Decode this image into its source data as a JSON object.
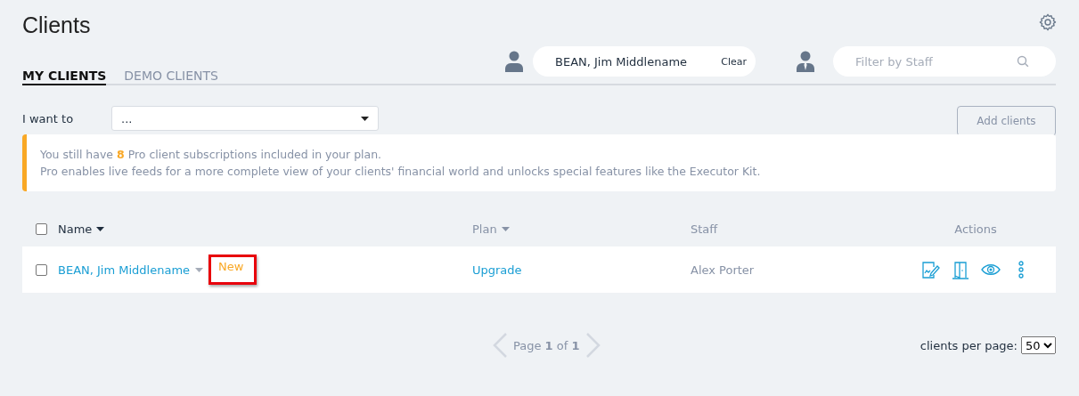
{
  "title": "Clients",
  "tabs": [
    {
      "label": "MY CLIENTS",
      "selected": true
    },
    {
      "label": "DEMO CLIENTS",
      "selected": false
    }
  ],
  "client_search": {
    "value": "BEAN, Jim Middlename",
    "clear_label": "Clear"
  },
  "staff_filter": {
    "placeholder": "Filter by Staff"
  },
  "action_select": {
    "label": "I want to",
    "value": "..."
  },
  "add_button": "Add clients",
  "notice": {
    "lines": [
      "You still have **8** Pro client subscriptions included in your plan.",
      "Pro enables live feeds for a more complete view of your clients' financial world and unlocks special features like the Executor Kit."
    ]
  },
  "table": {
    "select_all_checked": false,
    "columns": [
      {
        "label": "Name",
        "sortable": true,
        "sorted": true
      },
      {
        "label": "Plan",
        "sortable": true,
        "sorted": false
      },
      {
        "label": "Staff",
        "sortable": false,
        "sorted": false
      },
      {
        "label": "Actions",
        "sortable": false,
        "sorted": false
      }
    ],
    "rows": [
      {
        "checked": false,
        "name": "BEAN, Jim Middlename",
        "badge": "New",
        "badge_highlighted": true,
        "plan": "Upgrade",
        "staff": "Alex Porter"
      }
    ]
  },
  "pagination": {
    "text": "Page **1** of **1**",
    "prev_disabled": true,
    "next_disabled": true
  },
  "per_page": {
    "label": "clients per page:",
    "value": "50"
  }
}
